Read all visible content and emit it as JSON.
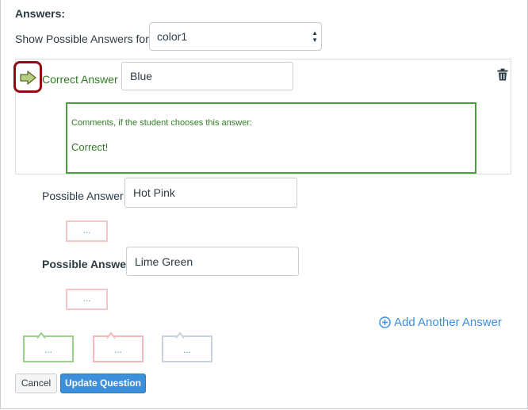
{
  "answers": {
    "heading": "Answers:",
    "show_label": "Show Possible Answers for",
    "select_value": "color1"
  },
  "correct": {
    "label": "Correct Answer",
    "value": "Blue",
    "comment_label": "Comments, if the student chooses this answer:",
    "comment_text": "Correct!"
  },
  "possible": [
    {
      "label": "Possible Answer",
      "value": "Hot Pink",
      "comment_placeholder": "..."
    },
    {
      "label": "Possible Answer",
      "value": "Lime Green",
      "comment_placeholder": "..."
    }
  ],
  "add_another_label": "Add Another Answer",
  "general_comments": [
    {
      "placeholder": "...",
      "color": "#9ad08e"
    },
    {
      "placeholder": "...",
      "color": "#f4b9b9"
    },
    {
      "placeholder": "...",
      "color": "#c6d2e0"
    }
  ],
  "buttons": {
    "cancel": "Cancel",
    "update": "Update Question"
  },
  "icons": {
    "correct_arrow": "arrow-right-icon",
    "delete": "trash-icon",
    "add": "plus-circle-icon"
  },
  "colors": {
    "correct_green": "#347b28",
    "link_blue": "#3a8ee6",
    "primary_button": "#3c8fdb",
    "highlight_border": "#8b0f14"
  }
}
